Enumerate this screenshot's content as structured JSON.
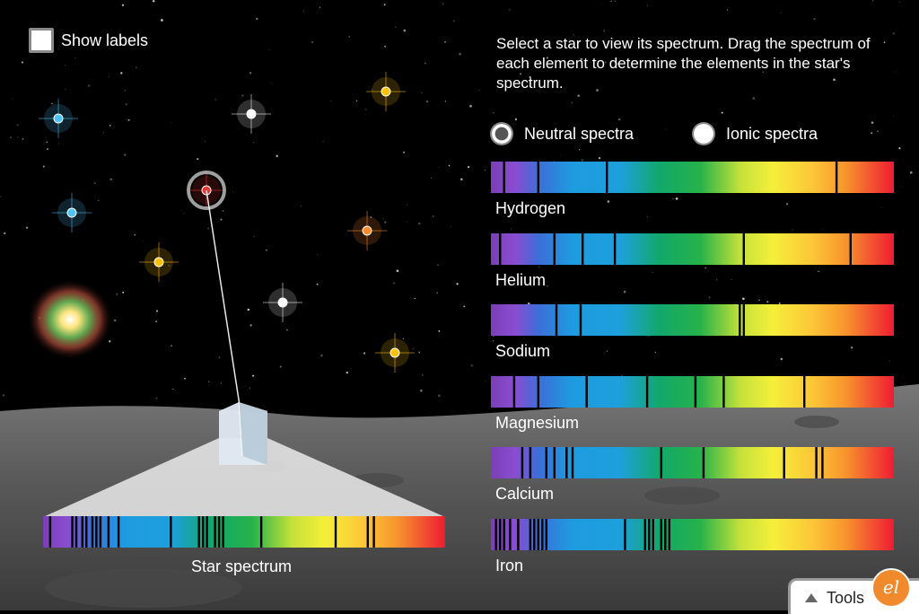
{
  "controls": {
    "show_labels": "Show labels",
    "instructions": "Select a star to view its spectrum. Drag the spectrum of each element to determine the elements in the star's spectrum.",
    "neutral": "Neutral spectra",
    "ionic": "Ionic spectra",
    "selected_mode": "neutral"
  },
  "spectra": [
    {
      "name": "Hydrogen",
      "lines": [
        0.03,
        0.115,
        0.285,
        0.855
      ]
    },
    {
      "name": "Helium",
      "lines": [
        0.02,
        0.155,
        0.225,
        0.305,
        0.625,
        0.89
      ]
    },
    {
      "name": "Sodium",
      "lines": [
        0.16,
        0.22,
        0.615,
        0.625
      ]
    },
    {
      "name": "Magnesium",
      "lines": [
        0.055,
        0.115,
        0.235,
        0.385,
        0.505,
        0.575,
        0.775
      ]
    },
    {
      "name": "Calcium",
      "lines": [
        0.075,
        0.095,
        0.135,
        0.155,
        0.185,
        0.2,
        0.42,
        0.525,
        0.725,
        0.805,
        0.82
      ]
    },
    {
      "name": "Iron",
      "lines": [
        0.01,
        0.02,
        0.03,
        0.045,
        0.065,
        0.095,
        0.105,
        0.115,
        0.125,
        0.135,
        0.33,
        0.38,
        0.39,
        0.4,
        0.42,
        0.43,
        0.44
      ]
    }
  ],
  "star_spectrum": {
    "label": "Star spectrum",
    "lines": [
      0.015,
      0.07,
      0.08,
      0.095,
      0.105,
      0.12,
      0.13,
      0.14,
      0.16,
      0.185,
      0.315,
      0.385,
      0.395,
      0.405,
      0.425,
      0.435,
      0.445,
      0.54,
      0.725,
      0.805,
      0.82
    ]
  },
  "stars": [
    {
      "name": "star-blue-1",
      "color": "#4fc3f7"
    },
    {
      "name": "star-white-1",
      "color": "#ffffff"
    },
    {
      "name": "star-yellow-1",
      "color": "#ffc107"
    },
    {
      "name": "star-red-selected",
      "color": "#e53935"
    },
    {
      "name": "star-blue-2",
      "color": "#4fc3f7"
    },
    {
      "name": "star-orange-1",
      "color": "#ff8a2a"
    },
    {
      "name": "star-yellow-2",
      "color": "#ffc107"
    },
    {
      "name": "star-white-2",
      "color": "#ffffff"
    },
    {
      "name": "star-yellow-3",
      "color": "#ffc107"
    }
  ],
  "tools": {
    "label": "Tools",
    "logo": "el"
  }
}
